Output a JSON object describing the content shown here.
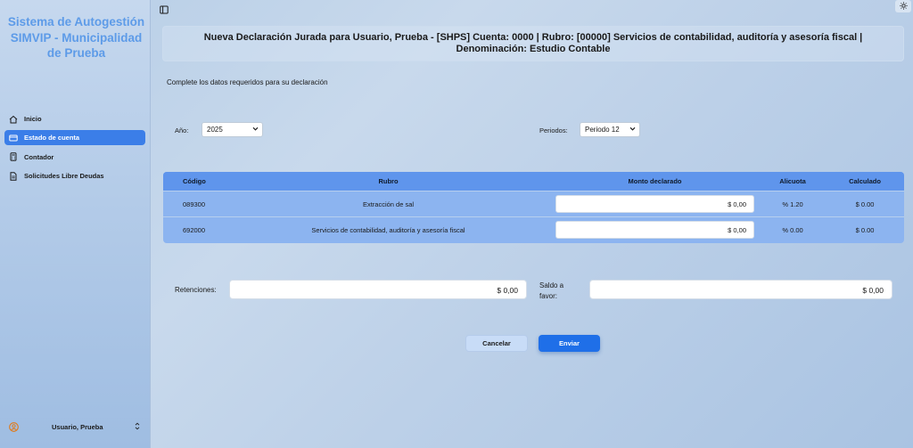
{
  "sidebar": {
    "brand": "Sistema de Autogestión SIMVIP - Municipalidad de Prueba",
    "items": [
      {
        "label": "Inicio",
        "icon": "home-icon"
      },
      {
        "label": "Estado de cuenta",
        "icon": "card-icon",
        "active": true
      },
      {
        "label": "Contador",
        "icon": "calculator-icon"
      },
      {
        "label": "Solicitudes Libre Deudas",
        "icon": "document-icon"
      }
    ],
    "user": {
      "name": "Usuario, Prueba"
    }
  },
  "header": {
    "title": "Nueva Declaración Jurada para Usuario, Prueba - [SHPS] Cuenta: 0000 | Rubro: [00000] Servicios de contabilidad, auditoría y asesoría fiscal | Denominación: Estudio Contable"
  },
  "form": {
    "subtitle": "Complete los datos requeridos para su declaración",
    "year_label": "Año:",
    "year_value": "2025",
    "period_label": "Periodos:",
    "period_value": "Periodo 12"
  },
  "table": {
    "headers": {
      "codigo": "Código",
      "rubro": "Rubro",
      "monto": "Monto declarado",
      "alicuota": "Alicuota",
      "calculado": "Calculado"
    },
    "rows": [
      {
        "codigo": "089300",
        "rubro": "Extracción de sal",
        "monto": "$ 0,00",
        "alicuota": "% 1.20",
        "calculado": "$ 0.00"
      },
      {
        "codigo": "692000",
        "rubro": "Servicios de contabilidad, auditoría y asesoría fiscal",
        "monto": "$ 0,00",
        "alicuota": "% 0.00",
        "calculado": "$ 0.00"
      }
    ]
  },
  "totals": {
    "retenciones_label": "Retenciones:",
    "retenciones_value": "$ 0,00",
    "saldo_label_1": "Saldo a",
    "saldo_label_2": "favor:",
    "saldo_value": "$ 0,00"
  },
  "actions": {
    "cancel": "Cancelar",
    "send": "Enviar"
  },
  "colors": {
    "accent": "#1f6fe8",
    "brand": "#5d9be8",
    "table_header": "#5f95ec"
  }
}
